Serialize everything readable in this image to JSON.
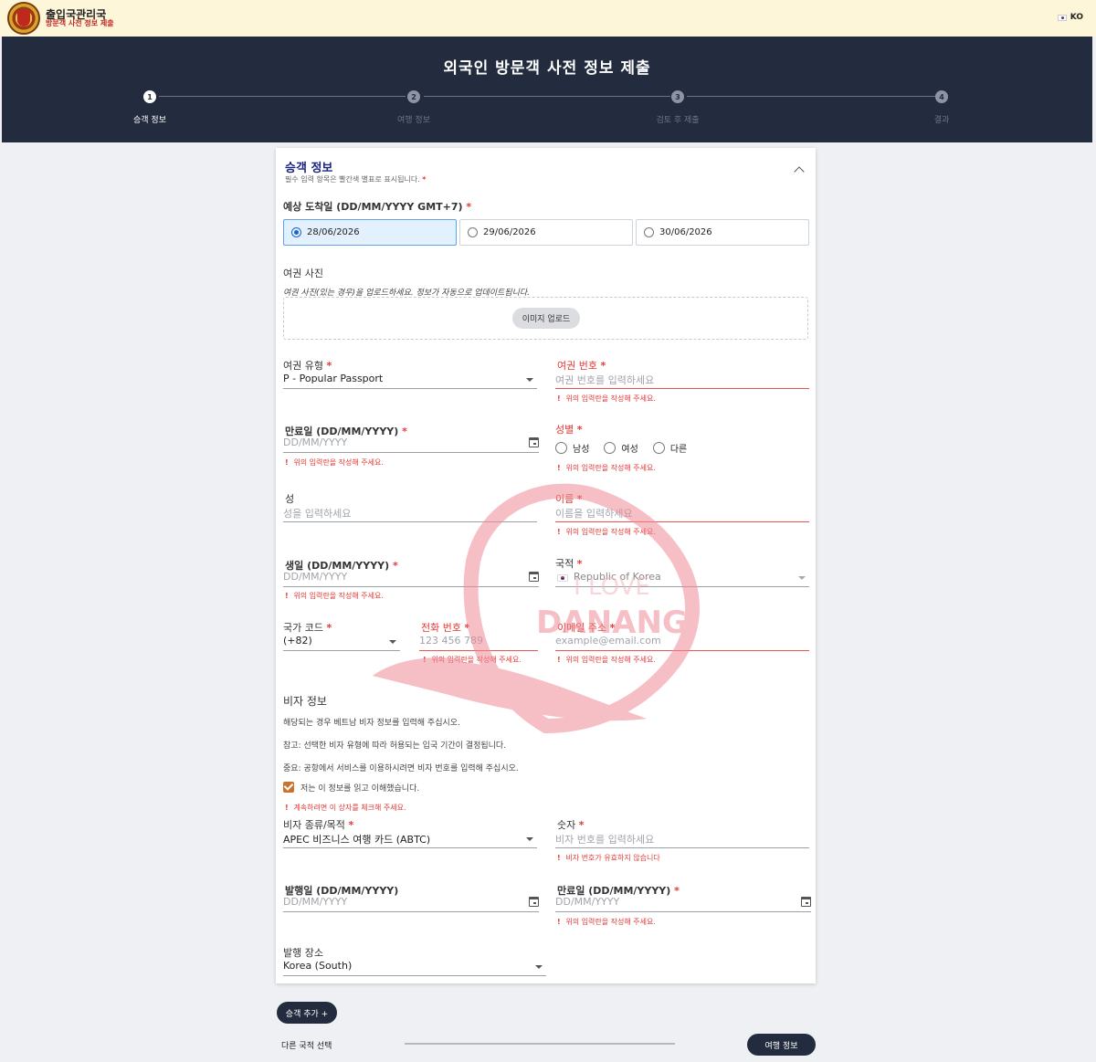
{
  "header": {
    "title": "출입국관리국",
    "subtitle": "방문객 사전 정보 제출",
    "lang_code": "KO"
  },
  "hero": {
    "title": "외국인 방문객 사전 정보 제출",
    "steps": [
      {
        "num": "1",
        "label": "승객 정보",
        "active": true
      },
      {
        "num": "2",
        "label": "여행 정보",
        "active": false
      },
      {
        "num": "3",
        "label": "검토 후 제출",
        "active": false
      },
      {
        "num": "4",
        "label": "결과",
        "active": false
      }
    ]
  },
  "form": {
    "section_title": "승객 정보",
    "section_sub": "필수 입력 항목은 빨간색 별표로 표시됩니다.",
    "required_mark": "*",
    "arrival_label": "예상 도착일 (DD/MM/YYYY GMT+7)",
    "arrival_options": [
      "28/06/2026",
      "29/06/2026",
      "30/06/2026"
    ],
    "arrival_selected": "28/06/2026",
    "passport_photo_label": "여권 사진",
    "passport_photo_hint": "여권 사진(있는 경우)을 업로드하세요. 정보가 자동으로 업데이트됩니다.",
    "upload_button": "이미지 업로드",
    "passport_type_label": "여권 유형",
    "passport_type_value": "P - Popular Passport",
    "passport_no_label": "여권 번호",
    "passport_no_placeholder": "여권 번호를 입력하세요",
    "required_error": "위의 입력란을 작성해 주세요.",
    "expiry_label": "만료일 (DD/MM/YYYY)",
    "date_placeholder": "DD/MM/YYYY",
    "gender_label": "성별",
    "gender_options": [
      "남성",
      "여성",
      "다른"
    ],
    "surname_label": "성",
    "surname_placeholder": "성을 입력하세요",
    "given_name_label": "이름",
    "given_name_placeholder": "이름을 입력하세요",
    "birth_label": "생일 (DD/MM/YYYY)",
    "nationality_label": "국적",
    "nationality_value": "Republic of Korea",
    "country_code_label": "국가 코드",
    "country_code_value": "(+82)",
    "phone_label": "전화 번호",
    "phone_placeholder": "123 456 789",
    "email_label": "이메일 주소",
    "email_placeholder": "example@email.com",
    "visa_title": "비자 정보",
    "visa_p1": "해당되는 경우 베트남 비자 정보를 입력해 주십시오.",
    "visa_p2": "참고: 선택한 비자 유형에 따라 허용되는 입국 기간이 결정됩니다.",
    "visa_p3": "중요: 공항에서 서비스를 이용하시려면 비자 번호를 입력해 주십시오.",
    "acknowledge_label": "저는 이 정보를 읽고 이해했습니다.",
    "acknowledge_error": "계속하려면 이 상자를 체크해 주세요.",
    "visa_type_label": "비자 종류/목적",
    "visa_type_value": "APEC 비즈니스 여행 카드 (ABTC)",
    "visa_no_label": "숫자",
    "visa_no_placeholder": "비자 번호를 입력하세요",
    "visa_no_error": "비자 번호가 유효하지 않습니다",
    "issue_date_label": "발행일 (DD/MM/YYYY)",
    "visa_expiry_label": "만료일 (DD/MM/YYYY)",
    "issue_place_label": "발행 장소",
    "issue_place_value": "Korea (South)"
  },
  "watermark": {
    "line1": "I LOVE",
    "line2": "DANANG"
  },
  "footer": {
    "add_passenger": "승객 추가 +",
    "other_nationality": "다른 국적 선택",
    "next_button": "여행 정보"
  },
  "colors": {
    "navy": "#232b3e",
    "error": "#e53935",
    "topbar_bg": "#fdf6d8",
    "accent_blue": "#1e63c6"
  }
}
